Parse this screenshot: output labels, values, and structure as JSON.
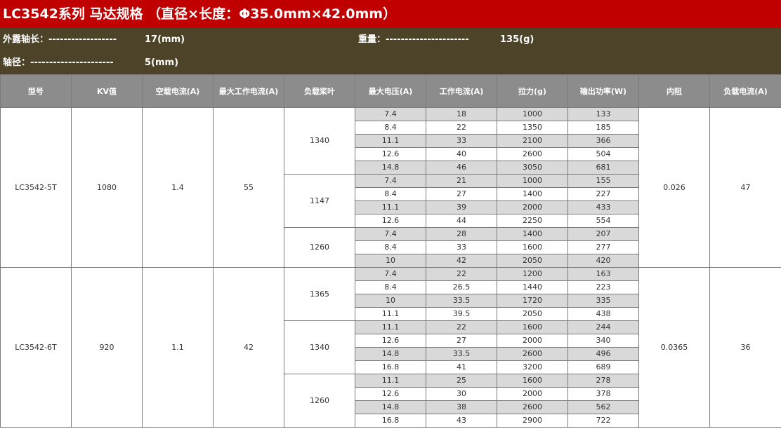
{
  "title": "LC3542系列  马达规格 （直径×长度：Φ35.0mm×42.0mm）",
  "info": {
    "shaft_label": "外露轴长：------------------",
    "shaft_value": "17(mm)",
    "weight_label": "重量：----------------------",
    "weight_value": "135(g)",
    "diameter_label": "轴径：----------------------",
    "diameter_value": "5(mm)"
  },
  "headers": [
    "型号",
    "KV值",
    "空载电流(A)",
    "最大工作电流(A)",
    "负载桨叶",
    "最大电压(A)",
    "工作电流(A)",
    "拉力(g)",
    "输出功率(W)",
    "内阻",
    "负载电流(A)"
  ],
  "motors": [
    {
      "model": "LC3542-5T",
      "kv": "1080",
      "noload": "1.4",
      "maxcur": "55",
      "resistance": "0.026",
      "loadcur": "47",
      "props": [
        {
          "prop": "1340",
          "rows": [
            [
              "7.4",
              "18",
              "1000",
              "133"
            ],
            [
              "8.4",
              "22",
              "1350",
              "185"
            ],
            [
              "11.1",
              "33",
              "2100",
              "366"
            ],
            [
              "12.6",
              "40",
              "2600",
              "504"
            ],
            [
              "14.8",
              "46",
              "3050",
              "681"
            ]
          ]
        },
        {
          "prop": "1147",
          "rows": [
            [
              "7.4",
              "21",
              "1000",
              "155"
            ],
            [
              "8.4",
              "27",
              "1400",
              "227"
            ],
            [
              "11.1",
              "39",
              "2000",
              "433"
            ],
            [
              "12.6",
              "44",
              "2250",
              "554"
            ]
          ]
        },
        {
          "prop": "1260",
          "rows": [
            [
              "7.4",
              "28",
              "1400",
              "207"
            ],
            [
              "8.4",
              "33",
              "1600",
              "277"
            ],
            [
              "10",
              "42",
              "2050",
              "420"
            ]
          ]
        }
      ]
    },
    {
      "model": "LC3542-6T",
      "kv": "920",
      "noload": "1.1",
      "maxcur": "42",
      "resistance": "0.0365",
      "loadcur": "36",
      "props": [
        {
          "prop": "1365",
          "rows": [
            [
              "7.4",
              "22",
              "1200",
              "163"
            ],
            [
              "8.4",
              "26.5",
              "1440",
              "223"
            ],
            [
              "10",
              "33.5",
              "1720",
              "335"
            ],
            [
              "11.1",
              "39.5",
              "2050",
              "438"
            ]
          ]
        },
        {
          "prop": "1340",
          "rows": [
            [
              "11.1",
              "22",
              "1600",
              "244"
            ],
            [
              "12.6",
              "27",
              "2000",
              "340"
            ],
            [
              "14.8",
              "33.5",
              "2600",
              "496"
            ],
            [
              "16.8",
              "41",
              "3200",
              "689"
            ]
          ]
        },
        {
          "prop": "1260",
          "rows": [
            [
              "11.1",
              "25",
              "1600",
              "278"
            ],
            [
              "12.6",
              "30",
              "2000",
              "378"
            ],
            [
              "14.8",
              "38",
              "2600",
              "562"
            ],
            [
              "16.8",
              "43",
              "2900",
              "722"
            ]
          ]
        }
      ]
    }
  ]
}
